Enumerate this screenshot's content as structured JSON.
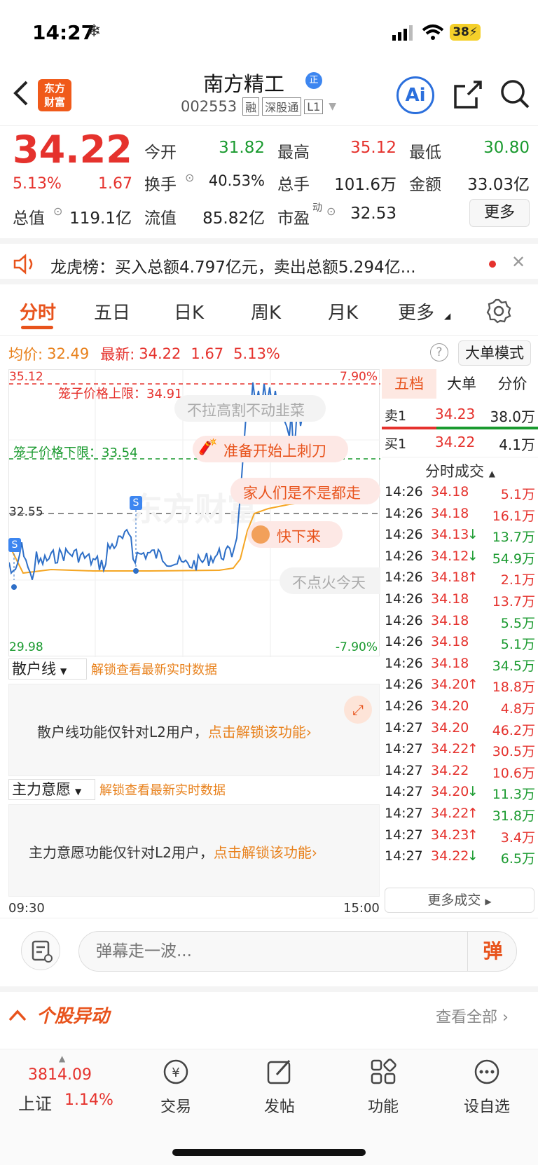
{
  "status": {
    "time": "14:27",
    "battery": "38"
  },
  "nav": {
    "logo_line1": "东方",
    "logo_line2": "财富",
    "title": "南方精工",
    "code": "002553",
    "tags": [
      "融",
      "深股通",
      "L1"
    ],
    "ai_label": "Ai"
  },
  "quote": {
    "price": "34.22",
    "pct": "5.13%",
    "chg": "1.67",
    "open_label": "今开",
    "open": "31.82",
    "high_label": "最高",
    "high": "35.12",
    "low_label": "最低",
    "low": "30.80",
    "turnover_label": "换手",
    "turnover": "40.53%",
    "vol_label": "总手",
    "vol": "101.6万",
    "amount_label": "金额",
    "amount": "33.03亿",
    "mcap_label": "总值",
    "mcap": "119.1亿",
    "float_label": "流值",
    "float": "85.82亿",
    "pe_label": "市盈",
    "pe_sup": "动",
    "pe": "32.53",
    "more": "更多"
  },
  "lhb": {
    "text": "龙虎榜：买入总额4.797亿元，卖出总额5.294亿..."
  },
  "tabs": [
    "分时",
    "五日",
    "日K",
    "周K",
    "月K",
    "更多"
  ],
  "info": {
    "avg_label": "均价:",
    "avg": "32.49",
    "last_label": "最新:",
    "last": "34.22",
    "chg": "1.67",
    "pct": "5.13%",
    "mode_button": "大单模式"
  },
  "chart": {
    "top_price": "35.12",
    "top_pct": "7.90%",
    "bottom_price": "29.98",
    "bottom_pct": "-7.90%",
    "prev_close": "32.55",
    "cage_upper": "笼子价格上限：34.91",
    "cage_lower": "笼子价格下限：33.54",
    "time_start": "09:30",
    "time_end": "15:00",
    "marker": "S",
    "watermark": "东方财富",
    "danmu": [
      "不拉高割不动韭菜",
      "准备开始上刺刀",
      "家人们是不是都走",
      "快下来",
      "不点火今天"
    ]
  },
  "right_tabs": [
    "五档",
    "大单",
    "分价"
  ],
  "orderbook": {
    "sell_label": "卖1",
    "sell_price": "34.23",
    "sell_vol": "38.0万",
    "buy_label": "买1",
    "buy_price": "34.22",
    "buy_vol": "4.1万"
  },
  "trades_title": "分时成交",
  "trades": [
    {
      "t": "14:26",
      "p": "34.18",
      "d": "",
      "v": "5.1万",
      "vc": "red"
    },
    {
      "t": "14:26",
      "p": "34.18",
      "d": "",
      "v": "16.1万",
      "vc": "red"
    },
    {
      "t": "14:26",
      "p": "34.13",
      "d": "↓",
      "v": "13.7万",
      "vc": "green"
    },
    {
      "t": "14:26",
      "p": "34.12",
      "d": "↓",
      "v": "54.9万",
      "vc": "green"
    },
    {
      "t": "14:26",
      "p": "34.18",
      "d": "↑",
      "v": "2.1万",
      "vc": "red"
    },
    {
      "t": "14:26",
      "p": "34.18",
      "d": "",
      "v": "13.7万",
      "vc": "red"
    },
    {
      "t": "14:26",
      "p": "34.18",
      "d": "",
      "v": "5.5万",
      "vc": "green"
    },
    {
      "t": "14:26",
      "p": "34.18",
      "d": "",
      "v": "5.1万",
      "vc": "green"
    },
    {
      "t": "14:26",
      "p": "34.18",
      "d": "",
      "v": "34.5万",
      "vc": "green"
    },
    {
      "t": "14:26",
      "p": "34.20",
      "d": "↑",
      "v": "18.8万",
      "vc": "red"
    },
    {
      "t": "14:26",
      "p": "34.20",
      "d": "",
      "v": "4.8万",
      "vc": "red"
    },
    {
      "t": "14:27",
      "p": "34.20",
      "d": "",
      "v": "46.2万",
      "vc": "red"
    },
    {
      "t": "14:27",
      "p": "34.22",
      "d": "↑",
      "v": "30.5万",
      "vc": "red"
    },
    {
      "t": "14:27",
      "p": "34.22",
      "d": "",
      "v": "10.6万",
      "vc": "red"
    },
    {
      "t": "14:27",
      "p": "34.20",
      "d": "↓",
      "v": "11.3万",
      "vc": "green"
    },
    {
      "t": "14:27",
      "p": "34.22",
      "d": "↑",
      "v": "31.8万",
      "vc": "green"
    },
    {
      "t": "14:27",
      "p": "34.23",
      "d": "↑",
      "v": "3.4万",
      "vc": "red"
    },
    {
      "t": "14:27",
      "p": "34.22",
      "d": "↓",
      "v": "6.5万",
      "vc": "green"
    }
  ],
  "more_trades": "更多成交",
  "sanhu": {
    "label": "散户线",
    "unlock": "解锁查看最新实时数据",
    "msg": "散户线功能仅针对L2用户，",
    "link": "点击解锁该功能"
  },
  "zhuli": {
    "label": "主力意愿",
    "unlock": "解锁查看最新实时数据",
    "msg": "主力意愿功能仅针对L2用户，",
    "link": "点击解锁该功能"
  },
  "comment": {
    "placeholder": "弹幕走一波...",
    "danmu_btn": "弹"
  },
  "abnormal": {
    "title": "个股异动",
    "view_all": "查看全部"
  },
  "bottom": {
    "index_value": "3814.09",
    "index_name": "上证",
    "index_pct": "1.14%",
    "items": [
      "交易",
      "发帖",
      "功能",
      "设自选"
    ]
  },
  "colors": {
    "up": "#e5322d",
    "down": "#1a9a2f",
    "accent": "#e8531c",
    "price_line": "#2e6fc7",
    "avg_line": "#f5a623"
  }
}
